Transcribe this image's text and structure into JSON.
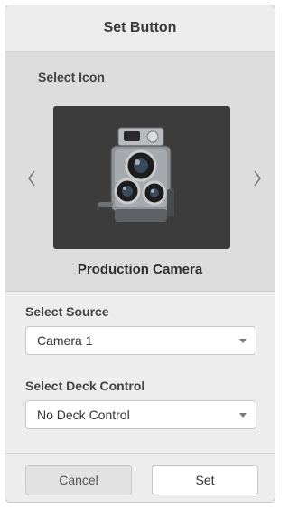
{
  "dialog": {
    "title": "Set Button"
  },
  "icon_section": {
    "label": "Select Icon",
    "selected_icon_name": "Production Camera",
    "icon": "production-camera-icon",
    "prev_icon": "chevron-left-icon",
    "next_icon": "chevron-right-icon"
  },
  "source_section": {
    "label": "Select Source",
    "value": "Camera 1"
  },
  "deck_section": {
    "label": "Select Deck Control",
    "value": "No Deck Control"
  },
  "buttons": {
    "cancel_label": "Cancel",
    "set_label": "Set"
  },
  "colors": {
    "panel": "#ededed",
    "icon_bg": "#3c3c3c",
    "icon_area": "#dcdcdc"
  }
}
